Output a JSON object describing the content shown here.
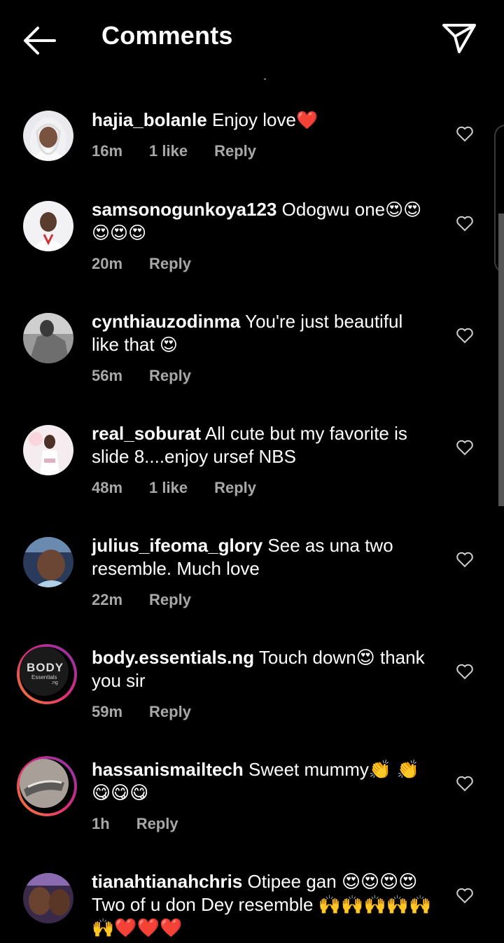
{
  "header": {
    "title": "Comments"
  },
  "comments": [
    {
      "username": "hajia_bolanle",
      "text": "Enjoy love",
      "emoji": "❤️",
      "time": "16m",
      "likes": "1 like",
      "reply": "Reply"
    },
    {
      "username": "samsonogunkoya123",
      "text": "Odogwu one",
      "emoji": "😍😍😍😍😍",
      "time": "20m",
      "likes": "",
      "reply": "Reply"
    },
    {
      "username": "cynthiauzodinma",
      "text": "You're just beautiful like that",
      "emoji": "😍",
      "time": "56m",
      "likes": "",
      "reply": "Reply"
    },
    {
      "username": "real_soburat",
      "text": "All cute but my favorite is slide 8....enjoy ursef NBS",
      "emoji": "",
      "time": "48m",
      "likes": "1 like",
      "reply": "Reply"
    },
    {
      "username": "julius_ifeoma_glory",
      "text": "See as una two resemble. Much love",
      "emoji": "",
      "time": "22m",
      "likes": "",
      "reply": "Reply"
    },
    {
      "username": "body.essentials.ng",
      "text": "Touch down😍 thank you sir",
      "emoji": "",
      "time": "59m",
      "likes": "",
      "reply": "Reply"
    },
    {
      "username": "hassanismailtech",
      "text": "Sweet mummy👏 👏 😋😋😋",
      "emoji": "",
      "time": "1h",
      "likes": "",
      "reply": "Reply"
    },
    {
      "username": "tianahtianahchris",
      "text": "Otipee gan 😍😍😍😍Two of u don Dey resemble 🙌🙌🙌🙌🙌🙌❤️❤️❤️",
      "emoji": "",
      "time": "",
      "likes": "",
      "reply": ""
    }
  ],
  "avatar_logo": {
    "line1": "BODY",
    "line2": "Essentials",
    "line3": ".ng"
  }
}
